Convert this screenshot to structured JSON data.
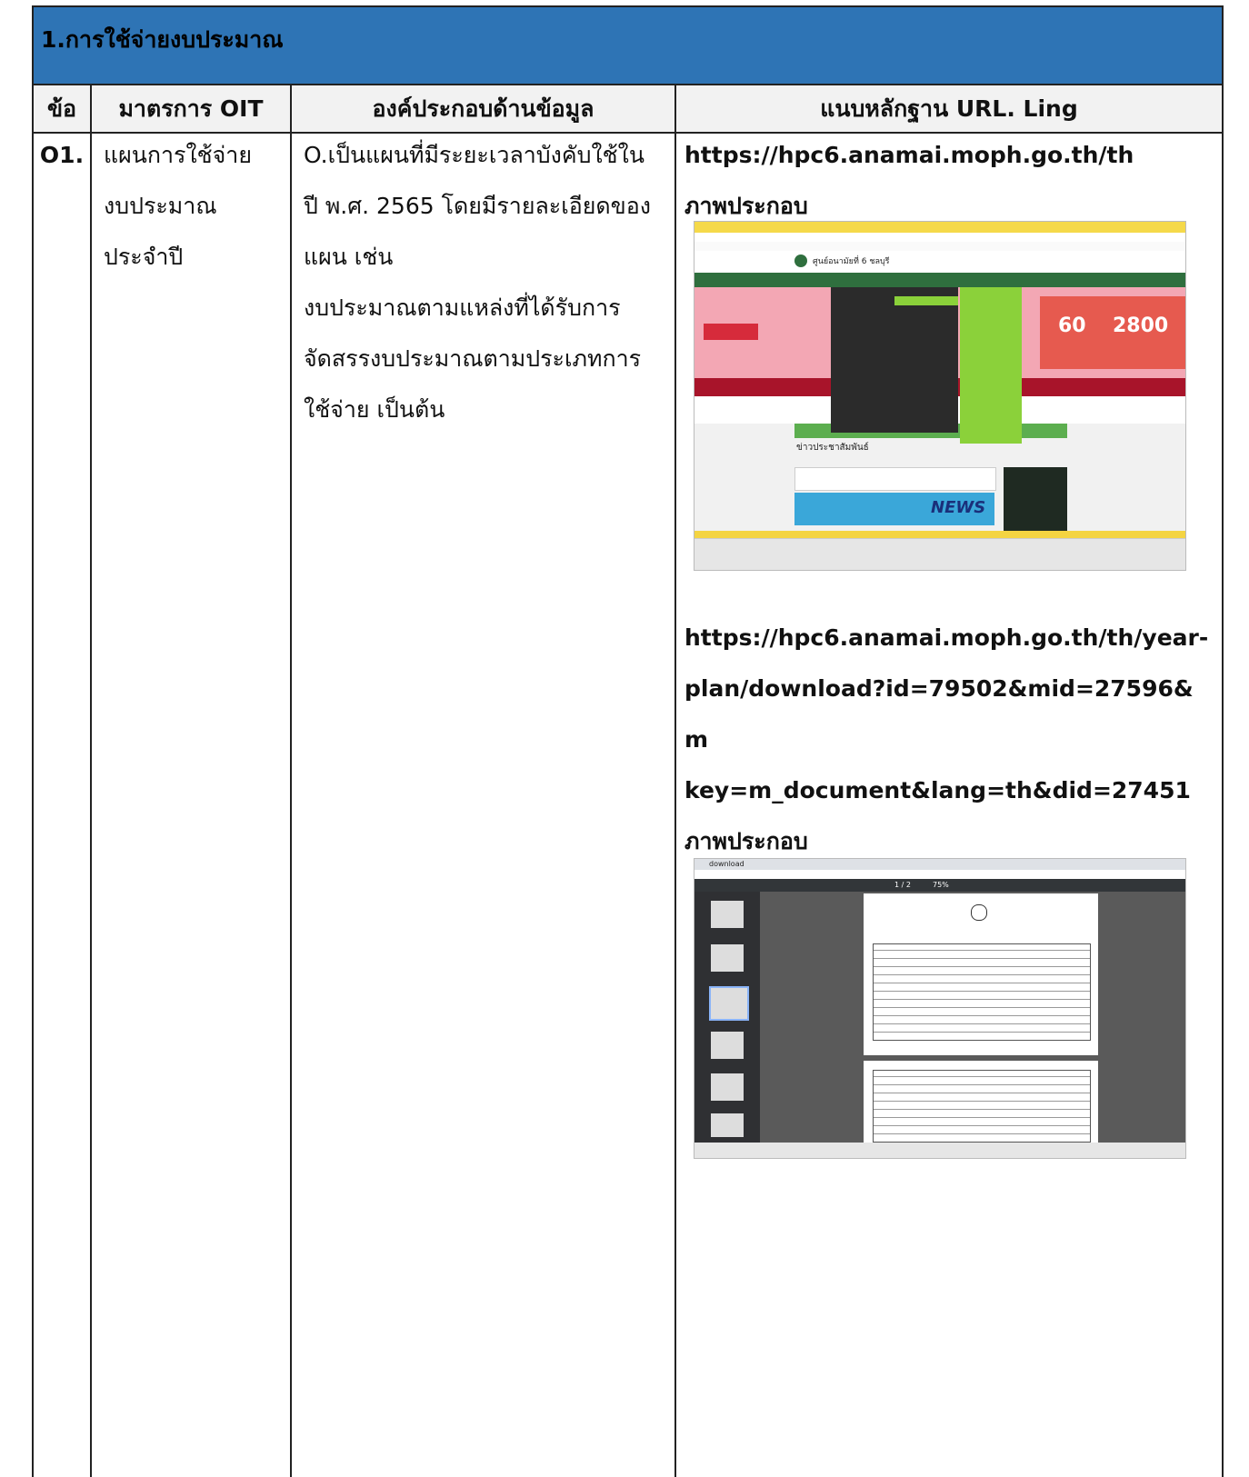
{
  "section_title": "1.การใช้จ่ายงบประมาณ",
  "columns": {
    "no": "ข้อ",
    "measure": "มาตรการ OIT",
    "element": "องค์ประกอบด้านข้อมูล",
    "evidence": "แนบหลักฐาน URL. Ling"
  },
  "row": {
    "no": "O1.",
    "measure_lines": [
      "แผนการใช้จ่าย",
      "งบประมาณ",
      "ประจำปี"
    ],
    "element_lines": [
      "O.เป็นแผนที่มีระยะเวลาบังคับใช้ใน",
      "ปี พ.ศ. 2565 โดยมีรายละเอียดของ",
      "แผน เช่น",
      "งบประมาณตามแหล่งที่ได้รับการ",
      "จัดสรรงบประมาณตามประเภทการ",
      "ใช้จ่าย เป็นต้น"
    ],
    "evidence_1": {
      "url": "https://hpc6.anamai.moph.go.th/th",
      "caption": "ภาพประกอบ"
    },
    "evidence_2": {
      "url_lines": [
        "https://hpc6.anamai.moph.go.th/th/year-",
        "plan/download?id=79502&mid=27596&m",
        "key=m_document&lang=th&did=27451"
      ],
      "caption": "ภาพประกอบ"
    }
  },
  "screenshot_1": {
    "site_name": "ศูนย์อนามัยที่ 6 ชลบุรี",
    "banner_numbers": [
      "60",
      "2800"
    ],
    "news_label": "NEWS",
    "section_label": "ข่าวประชาสัมพันธ์",
    "colors": {
      "nav": "#2f6f3e",
      "menu_dark": "#2b2b2b",
      "menu_green": "#8bd13a",
      "banner": "#d62b3b"
    }
  },
  "screenshot_2": {
    "tab_label": "download",
    "page_label": "1 / 2",
    "zoom": "75%",
    "colors": {
      "toolbar": "#323639",
      "viewer_bg": "#525659"
    }
  }
}
